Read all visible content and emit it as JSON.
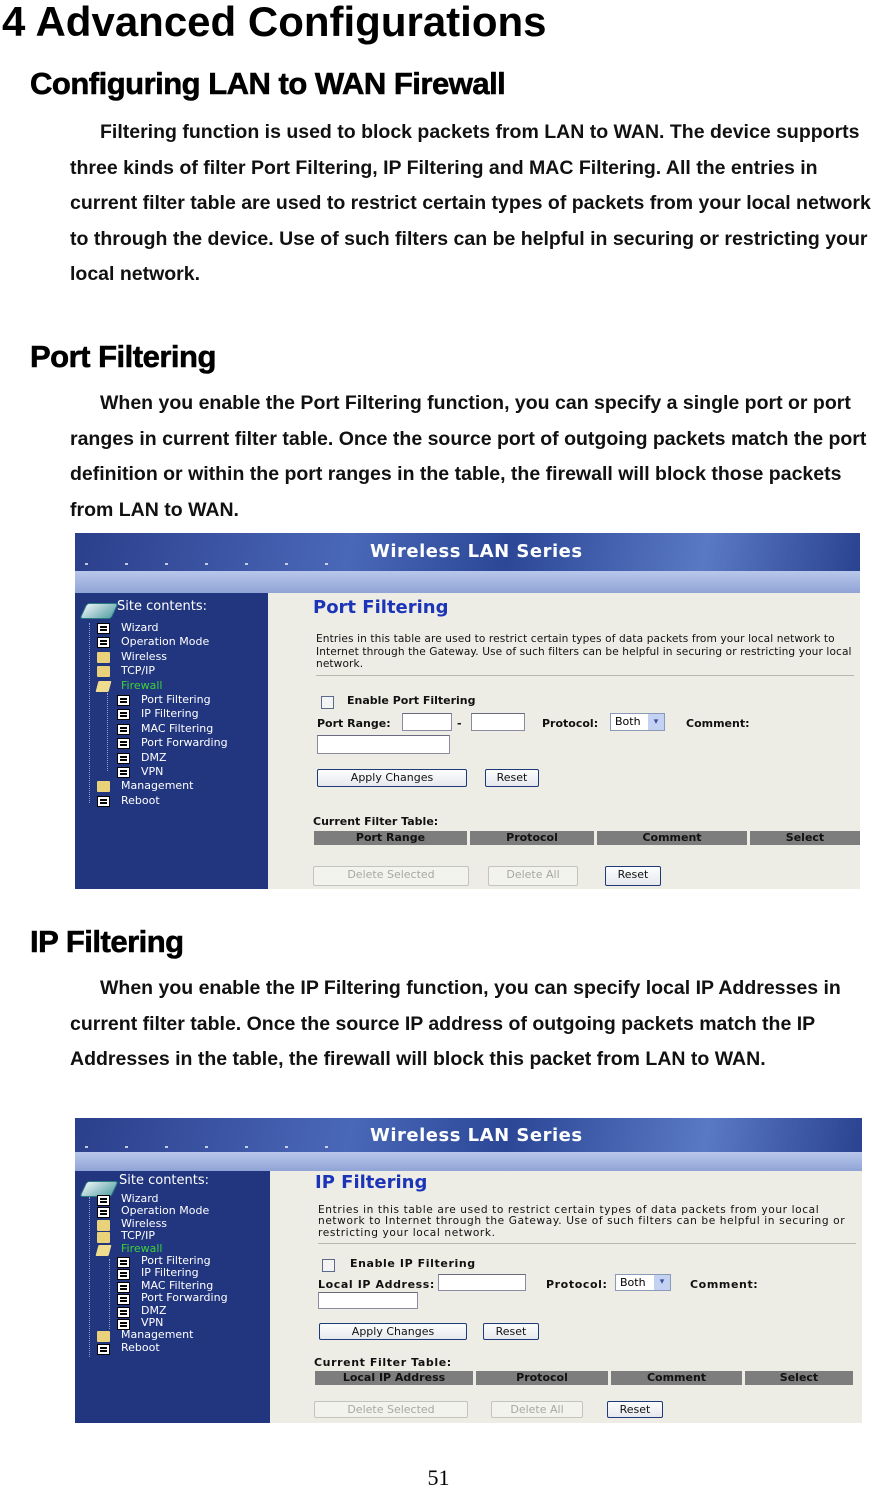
{
  "chapter_title": "4 Advanced Configurations",
  "section_title": "Configuring LAN to WAN Firewall",
  "section_body": "Filtering function is used to block packets from LAN to WAN. The device supports three kinds of filter Port Filtering, IP Filtering and MAC Filtering. All the entries in current filter table are used to restrict certain types of packets from your local network to through the device. Use of such filters can be helpful in securing or restricting your local network.",
  "port_filtering": {
    "heading": "Port Filtering",
    "body": "When you enable the Port Filtering function, you can specify a single port or port ranges in current filter table. Once the source port of outgoing packets match the port definition or within the port ranges in the table, the firewall will block those packets from LAN to WAN."
  },
  "ip_filtering": {
    "heading": "IP Filtering",
    "body": "When you enable the IP Filtering function, you can specify local IP Addresses in current filter table. Once the source IP address of outgoing packets match the IP Addresses in the table, the firewall will block this packet from LAN to WAN."
  },
  "page_number": "51",
  "screens": [
    {
      "banner": "Wireless LAN Series",
      "site_contents": "Site contents:",
      "tree": [
        {
          "label": "Wizard",
          "icon": "doc-icon",
          "level": 1
        },
        {
          "label": "Operation Mode",
          "icon": "doc-icon",
          "level": 1
        },
        {
          "label": "Wireless",
          "icon": "folder-icon",
          "level": 1
        },
        {
          "label": "TCP/IP",
          "icon": "folder-icon",
          "level": 1
        },
        {
          "label": "Firewall",
          "icon": "folder-open-icon",
          "level": 1,
          "active": true
        },
        {
          "label": "Port Filtering",
          "icon": "doc-icon",
          "level": 2
        },
        {
          "label": "IP Filtering",
          "icon": "doc-icon",
          "level": 2
        },
        {
          "label": "MAC Filtering",
          "icon": "doc-icon",
          "level": 2
        },
        {
          "label": "Port Forwarding",
          "icon": "doc-icon",
          "level": 2
        },
        {
          "label": "DMZ",
          "icon": "doc-icon",
          "level": 2
        },
        {
          "label": "VPN",
          "icon": "doc-icon",
          "level": 2
        },
        {
          "label": "Management",
          "icon": "folder-icon",
          "level": 1
        },
        {
          "label": "Reboot",
          "icon": "doc-icon",
          "level": 1
        }
      ],
      "title": "Port Filtering",
      "description": "Entries in this table are used to restrict certain types of data packets from your local network to Internet through the Gateway. Use of such filters can be helpful in securing or restricting your local network.",
      "enable_label": "Enable Port Filtering",
      "enabled": false,
      "field_label": "Port Range:",
      "range_separator": "-",
      "port_from": "",
      "port_to": "",
      "protocol_label": "Protocol:",
      "protocol_value": "Both",
      "comment_label": "Comment:",
      "comment_value": "",
      "apply_label": "Apply Changes",
      "reset_label": "Reset",
      "table_title": "Current Filter Table:",
      "columns": [
        "Port Range",
        "Protocol",
        "Comment",
        "Select"
      ],
      "rows": [],
      "delete_selected_label": "Delete Selected",
      "delete_all_label": "Delete All",
      "table_reset_label": "Reset"
    },
    {
      "banner": "Wireless LAN Series",
      "site_contents": "Site contents:",
      "tree": [
        {
          "label": "Wizard",
          "icon": "doc-icon",
          "level": 1
        },
        {
          "label": "Operation Mode",
          "icon": "doc-icon",
          "level": 1
        },
        {
          "label": "Wireless",
          "icon": "folder-icon",
          "level": 1
        },
        {
          "label": "TCP/IP",
          "icon": "folder-icon",
          "level": 1
        },
        {
          "label": "Firewall",
          "icon": "folder-open-icon",
          "level": 1,
          "active": true
        },
        {
          "label": "Port Filtering",
          "icon": "doc-icon",
          "level": 2
        },
        {
          "label": "IP Filtering",
          "icon": "doc-icon",
          "level": 2
        },
        {
          "label": "MAC Filtering",
          "icon": "doc-icon",
          "level": 2
        },
        {
          "label": "Port Forwarding",
          "icon": "doc-icon",
          "level": 2
        },
        {
          "label": "DMZ",
          "icon": "doc-icon",
          "level": 2
        },
        {
          "label": "VPN",
          "icon": "doc-icon",
          "level": 2
        },
        {
          "label": "Management",
          "icon": "folder-icon",
          "level": 1
        },
        {
          "label": "Reboot",
          "icon": "doc-icon",
          "level": 1
        }
      ],
      "title": "IP Filtering",
      "description": "Entries in this table are used to restrict certain types of data packets from your local network to Internet through the Gateway. Use of such filters can be helpful in securing or restricting your local network.",
      "enable_label": "Enable IP Filtering",
      "enabled": false,
      "field_label": "Local IP Address:",
      "ip_value": "",
      "protocol_label": "Protocol:",
      "protocol_value": "Both",
      "comment_label": "Comment:",
      "comment_value": "",
      "apply_label": "Apply Changes",
      "reset_label": "Reset",
      "table_title": "Current Filter Table:",
      "columns": [
        "Local IP Address",
        "Protocol",
        "Comment",
        "Select"
      ],
      "rows": [],
      "delete_selected_label": "Delete Selected",
      "delete_all_label": "Delete All",
      "table_reset_label": "Reset"
    }
  ],
  "colors": {
    "banner_bg": "#2b4796",
    "sidebar_bg": "#22357f",
    "content_bg": "#eeede5",
    "title_blue": "#1c34b8",
    "active_green": "#3cd23c",
    "table_header": "#7d7d7d"
  }
}
